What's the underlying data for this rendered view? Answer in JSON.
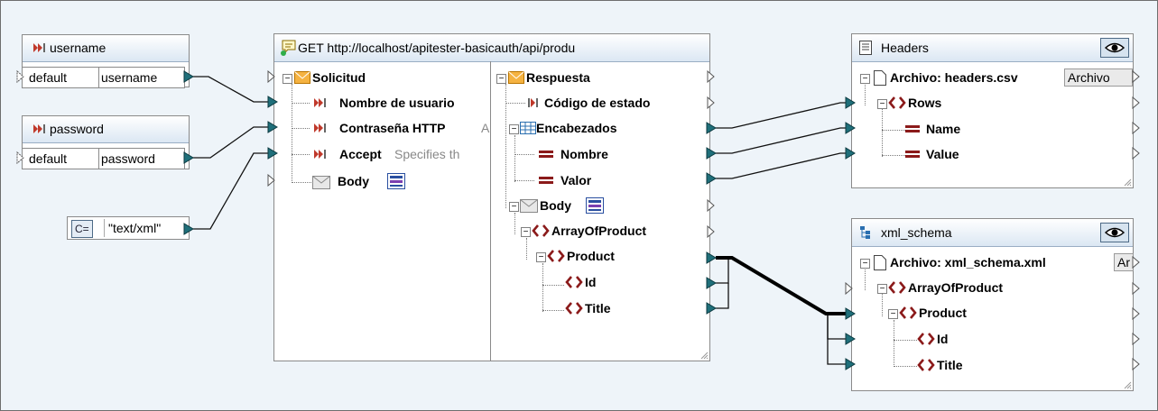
{
  "username_comp": {
    "title": "username",
    "default_label": "default",
    "value_label": "username"
  },
  "password_comp": {
    "title": "password",
    "default_label": "default",
    "value_label": "password"
  },
  "constant_comp": {
    "prefix": "C=",
    "value": "\"text/xml\""
  },
  "get_comp": {
    "title": "GET http://localhost/apitester-basicauth/api/produ",
    "request": {
      "label": "Solicitud",
      "user": "Nombre de usuario",
      "password": "Contraseña HTTP",
      "password_note": "A",
      "accept": "Accept",
      "accept_note": "Specifies th",
      "body": "Body"
    },
    "response": {
      "label": "Respuesta",
      "status": "Código de estado",
      "headers": "Encabezados",
      "name": "Nombre",
      "value": "Valor",
      "body": "Body",
      "array": "ArrayOfProduct",
      "product": "Product",
      "id": "Id",
      "title": "Title"
    }
  },
  "headers_comp": {
    "title": "Headers",
    "file_label": "Archivo: headers.csv",
    "file_button": "Archivo",
    "rows": "Rows",
    "name": "Name",
    "value": "Value"
  },
  "xml_comp": {
    "title": "xml_schema",
    "file_label": "Archivo: xml_schema.xml",
    "file_button": "Ar",
    "array": "ArrayOfProduct",
    "product": "Product",
    "id": "Id",
    "title_field": "Title"
  }
}
